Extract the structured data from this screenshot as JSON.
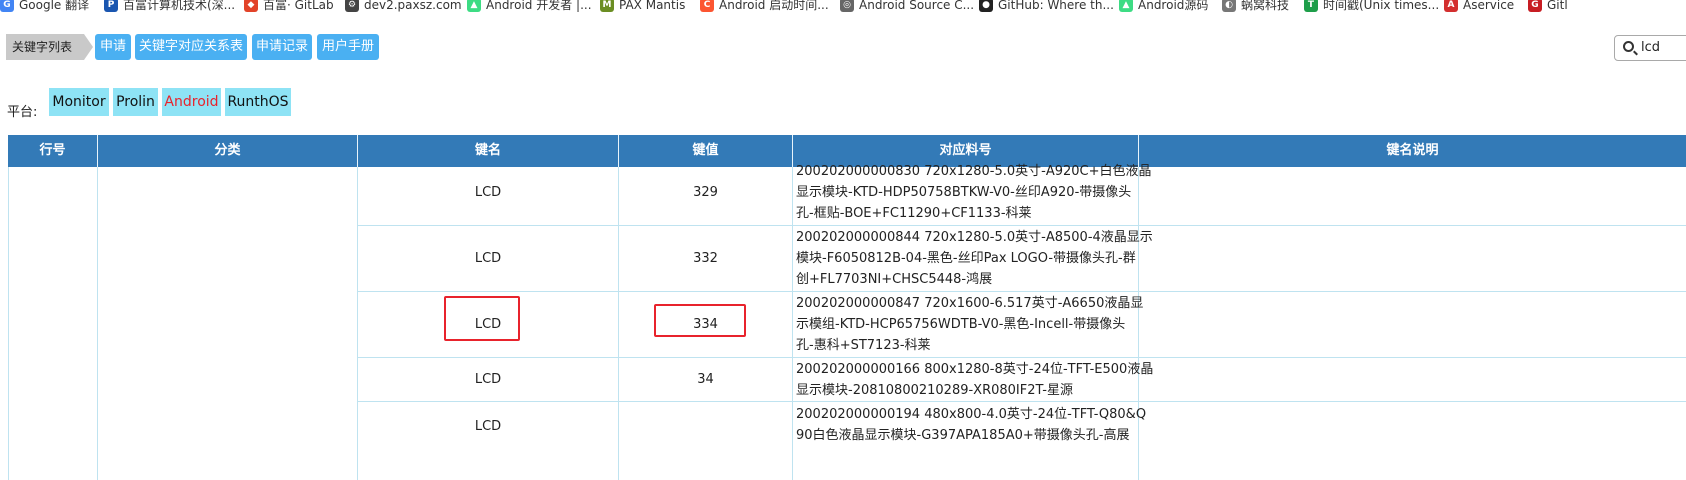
{
  "bookmarks": [
    {
      "label": "Google 翻译",
      "icon": "google-translate-icon",
      "color": "#4285f4"
    },
    {
      "label": "百富计算机技术(深...",
      "icon": "pax-logo-icon",
      "color": "#1a56b0"
    },
    {
      "label": "百富· GitLab",
      "icon": "gitlab-icon",
      "color": "#e24329"
    },
    {
      "label": "dev2.paxsz.com",
      "icon": "gear-icon",
      "color": "#444444"
    },
    {
      "label": "Android 开发者 |...",
      "icon": "android-icon",
      "color": "#3ddc84"
    },
    {
      "label": "PAX Mantis",
      "icon": "mantis-icon",
      "color": "#6b8e23"
    },
    {
      "label": "Android 启动时间...",
      "icon": "csdn-icon",
      "color": "#fc5531"
    },
    {
      "label": "Android Source C...",
      "icon": "globe-icon",
      "color": "#666666"
    },
    {
      "label": "GitHub: Where th...",
      "icon": "github-icon",
      "color": "#222222"
    },
    {
      "label": "Android源码",
      "icon": "android-icon",
      "color": "#3ddc84"
    },
    {
      "label": "蜗窝科技",
      "icon": "snail-icon",
      "color": "#777777"
    },
    {
      "label": "时间戳(Unix times...",
      "icon": "clock-icon",
      "color": "#1e9e4a"
    },
    {
      "label": "Aservice",
      "icon": "aservice-icon",
      "color": "#d32f2f"
    },
    {
      "label": "Gitl",
      "icon": "gitee-icon",
      "color": "#c71d23"
    }
  ],
  "toolbar": {
    "crumb": "关键字列表",
    "buttons": [
      "申请",
      "关键字对应关系表",
      "申请记录",
      "用户手册"
    ],
    "search_value": "lcd",
    "accent": "#4ab0f2"
  },
  "platforms": {
    "label": "平台:",
    "items": [
      "Monitor",
      "Prolin",
      "Android",
      "RunthOS"
    ],
    "active": "Android"
  },
  "table": {
    "headers": [
      "行号",
      "分类",
      "键名",
      "键值",
      "对应料号",
      "键名说明"
    ],
    "header_color": "#337ab7",
    "rows": [
      {
        "key": "LCD",
        "value": "329",
        "material": [
          "200202000000830 720x1280-5.0英寸-A920C+白色液晶",
          "显示模块-KTD-HDP50758BTKW-V0-丝印A920-带摄像头",
          "孔-框贴-BOE+FC11290+CF1133-科莱"
        ]
      },
      {
        "key": "LCD",
        "value": "332",
        "material": [
          "200202000000844 720x1280-5.0英寸-A8500-4液晶显示",
          "模块-F6050812B-04-黑色-丝印Pax LOGO-带摄像头孔-群",
          "创+FL7703NI+CHSC5448-鸿展"
        ]
      },
      {
        "key": "LCD",
        "value": "334",
        "material": [
          "200202000000847 720x1600-6.517英寸-A6650液晶显",
          "示模组-KTD-HCP65756WDTB-V0-黑色-Incell-带摄像头",
          "孔-惠科+ST7123-科莱"
        ]
      },
      {
        "key": "LCD",
        "value": "34",
        "material": [
          "200202000000166 800x1280-8英寸-24位-TFT-E500液晶",
          "显示模块-20810800210289-XR080IF2T-星源"
        ]
      },
      {
        "key": "LCD",
        "value": "",
        "material": [
          "200202000000194 480x800-4.0英寸-24位-TFT-Q80&Q",
          "90白色液晶显示模块-G397APA185A0+带摄像头孔-高展"
        ]
      }
    ]
  }
}
